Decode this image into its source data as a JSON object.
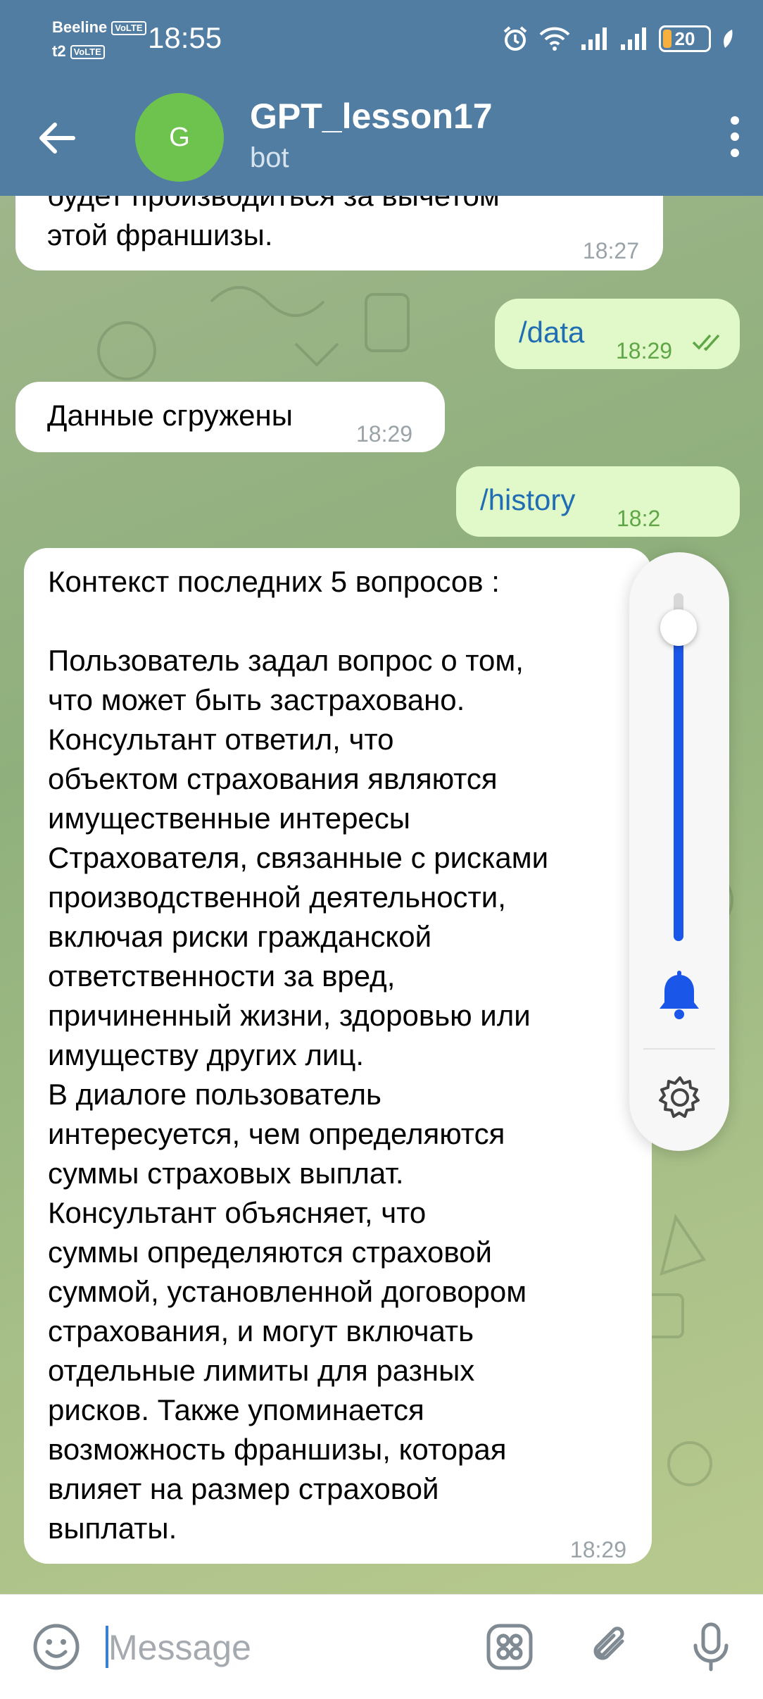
{
  "status_bar": {
    "carrier_1": "Beeline",
    "carrier_2": "t2",
    "volte": "VoLTE",
    "time": "18:55",
    "battery": "20",
    "battery_level": 0.2
  },
  "header": {
    "avatar_letter": "G",
    "title": "GPT_lesson17",
    "subtitle": "bot"
  },
  "messages": {
    "m1": {
      "lines": [
        "будет производиться за вычетом",
        "этой франшизы."
      ],
      "time": "18:27"
    },
    "m2": {
      "text": "/data",
      "time": "18:29"
    },
    "m3": {
      "text": "Данные сгружены",
      "time": "18:29"
    },
    "m4": {
      "text": "/history",
      "time": "18:2"
    },
    "m5": {
      "lines": [
        "Контекст последних 5 вопросов :",
        "",
        "Пользователь задал вопрос о том,",
        "что может быть застраховано.",
        "Консультант ответил, что",
        "объектом страхования являются",
        "имущественные интересы",
        "Страхователя, связанные с рисками",
        "производственной деятельности,",
        "включая риски гражданской",
        "ответственности за вред,",
        "причиненный жизни, здоровью или",
        "имуществу других лиц.",
        "В диалоге пользователь",
        "интересуется, чем определяются",
        "суммы страховых выплат.",
        "Консультант объясняет, что",
        "суммы определяются страховой",
        "суммой, установленной договором",
        "страхования, и могут включать",
        "отдельные лимиты для разных",
        "рисков. Также упоминается",
        "возможность франшизы, которая",
        "влияет на размер страховой",
        "выплаты."
      ],
      "time": "18:29"
    }
  },
  "volume_panel": {
    "level": 0.9,
    "accent": "#1a56e8"
  },
  "input": {
    "placeholder": "Message"
  },
  "colors": {
    "header": "#517da2",
    "outgoing_bubble": "#e1f8c8",
    "incoming_bubble": "#ffffff",
    "read_check": "#5fa647",
    "avatar": "#6ec34e"
  }
}
